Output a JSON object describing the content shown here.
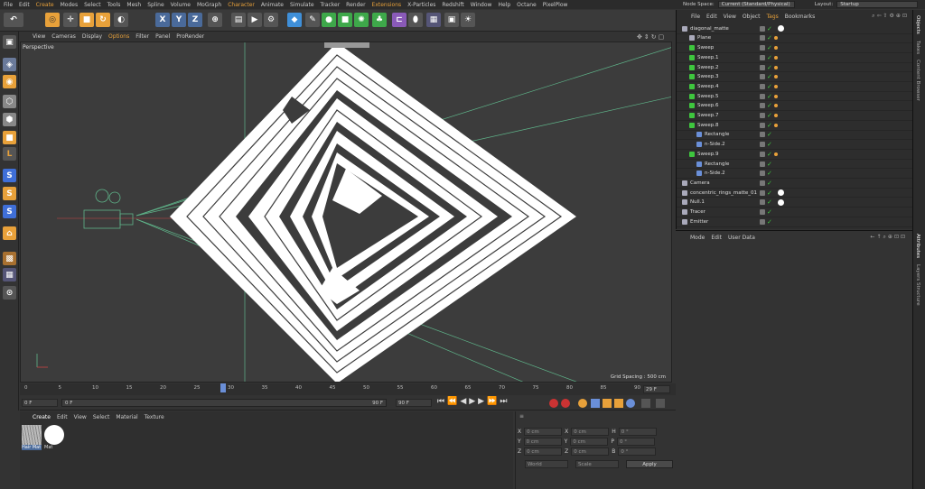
{
  "menubar": [
    "File",
    "Edit",
    "Create",
    "Modes",
    "Select",
    "Tools",
    "Mesh",
    "Spline",
    "Volume",
    "MoGraph",
    "Character",
    "Animate",
    "Simulate",
    "Tracker",
    "Render",
    "Extensions",
    "X-Particles",
    "Redshift",
    "Window",
    "Help",
    "Octane",
    "PixelPlow"
  ],
  "nodespace": {
    "label": "Node Space:",
    "value": "Current (Standard/Physical)",
    "layout_label": "Layout:",
    "layout_value": "Startup"
  },
  "viewport_menu": [
    "View",
    "Cameras",
    "Display",
    "Options",
    "Filter",
    "Panel",
    "ProRender"
  ],
  "viewport": {
    "name": "Perspective",
    "grid_spacing": "Grid Spacing : 500 cm"
  },
  "timeline": {
    "ticks": [
      "0",
      "5",
      "10",
      "15",
      "20",
      "25",
      "30",
      "35",
      "40",
      "45",
      "50",
      "55",
      "60",
      "65",
      "70",
      "75",
      "80",
      "85",
      "90"
    ],
    "current_frame": "29 F"
  },
  "transport": {
    "start": "0 F",
    "min": "0 F",
    "max": "90 F",
    "end": "90 F"
  },
  "material_menu": [
    "Create",
    "Edit",
    "View",
    "Select",
    "Material",
    "Texture"
  ],
  "materials": [
    {
      "name": "Hair Mat"
    },
    {
      "name": "Mat"
    }
  ],
  "coords": {
    "rows": [
      {
        "a": "X",
        "av": "0 cm",
        "b": "X",
        "bv": "0 cm",
        "c": "H",
        "cv": "0 °"
      },
      {
        "a": "Y",
        "av": "0 cm",
        "b": "Y",
        "bv": "0 cm",
        "c": "P",
        "cv": "0 °"
      },
      {
        "a": "Z",
        "av": "0 cm",
        "b": "Z",
        "bv": "0 cm",
        "c": "B",
        "cv": "0 °"
      }
    ],
    "world": "World",
    "scale": "Scale",
    "apply": "Apply"
  },
  "objmenu": [
    "File",
    "Edit",
    "View",
    "Object",
    "Tags",
    "Bookmarks"
  ],
  "objects": [
    {
      "name": "diagonal_matte",
      "indent": 0
    },
    {
      "name": "Plane",
      "indent": 1
    },
    {
      "name": "Sweep",
      "indent": 1
    },
    {
      "name": "Sweep.1",
      "indent": 1
    },
    {
      "name": "Sweep.2",
      "indent": 1
    },
    {
      "name": "Sweep.3",
      "indent": 1
    },
    {
      "name": "Sweep.4",
      "indent": 1
    },
    {
      "name": "Sweep.5",
      "indent": 1
    },
    {
      "name": "Sweep.6",
      "indent": 1
    },
    {
      "name": "Sweep.7",
      "indent": 1
    },
    {
      "name": "Sweep.8",
      "indent": 1
    },
    {
      "name": "Rectangle",
      "indent": 2
    },
    {
      "name": "n-Side.2",
      "indent": 2
    },
    {
      "name": "Sweep.9",
      "indent": 1
    },
    {
      "name": "Rectangle",
      "indent": 2
    },
    {
      "name": "n-Side.2",
      "indent": 2
    },
    {
      "name": "Camera",
      "indent": 0
    },
    {
      "name": "concentric_rings_matte_01",
      "indent": 0
    },
    {
      "name": "Null.1",
      "indent": 0
    },
    {
      "name": "Tracer",
      "indent": 0
    },
    {
      "name": "Emitter",
      "indent": 0
    }
  ],
  "attrmenu": [
    "Mode",
    "Edit",
    "User Data"
  ],
  "rightstrip": [
    "Objects",
    "Takes",
    "Content Browser",
    "Attributes",
    "Layers",
    "Structure"
  ]
}
